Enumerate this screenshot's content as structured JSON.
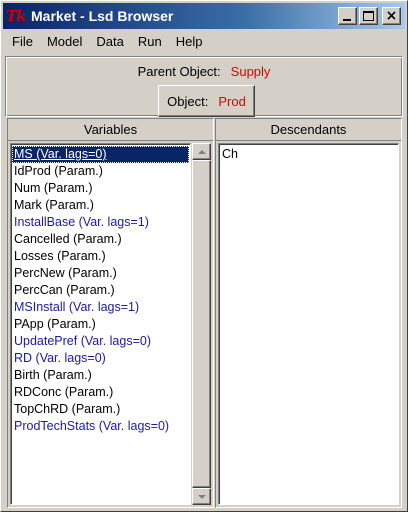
{
  "window": {
    "app_icon_text": "Tk",
    "title": "Market - Lsd Browser",
    "controls": {
      "minimize": "minimize",
      "maximize": "maximize",
      "close": "×"
    }
  },
  "menu": [
    "File",
    "Model",
    "Data",
    "Run",
    "Help"
  ],
  "parent": {
    "label": "Parent Object:",
    "value": "Supply"
  },
  "object": {
    "label": "Object:",
    "value": "Prod"
  },
  "variables": {
    "header": "Variables",
    "items": [
      {
        "text": "MS (Var. lags=0)",
        "kind": "var",
        "selected": true
      },
      {
        "text": "IdProd (Param.)",
        "kind": "param"
      },
      {
        "text": "Num (Param.)",
        "kind": "param"
      },
      {
        "text": "Mark (Param.)",
        "kind": "param"
      },
      {
        "text": "InstallBase (Var. lags=1)",
        "kind": "var"
      },
      {
        "text": "Cancelled (Param.)",
        "kind": "param"
      },
      {
        "text": "Losses (Param.)",
        "kind": "param"
      },
      {
        "text": "PercNew (Param.)",
        "kind": "param"
      },
      {
        "text": "PercCan (Param.)",
        "kind": "param"
      },
      {
        "text": "MSInstall (Var. lags=1)",
        "kind": "var"
      },
      {
        "text": "PApp (Param.)",
        "kind": "param"
      },
      {
        "text": "UpdatePref (Var. lags=0)",
        "kind": "var"
      },
      {
        "text": "RD (Var. lags=0)",
        "kind": "var"
      },
      {
        "text": "Birth (Param.)",
        "kind": "param"
      },
      {
        "text": "RDConc (Param.)",
        "kind": "param"
      },
      {
        "text": "TopChRD (Param.)",
        "kind": "param"
      },
      {
        "text": "ProdTechStats (Var. lags=0)",
        "kind": "var"
      }
    ]
  },
  "descendants": {
    "header": "Descendants",
    "items": [
      "Ch"
    ]
  },
  "colors": {
    "title_bar_start": "#0a246a",
    "title_bar_end": "#a6caf0",
    "face": "#d4d0c8",
    "selection": "#0a246a",
    "variable_text": "#1a1aa6",
    "object_value": "#e00000"
  }
}
